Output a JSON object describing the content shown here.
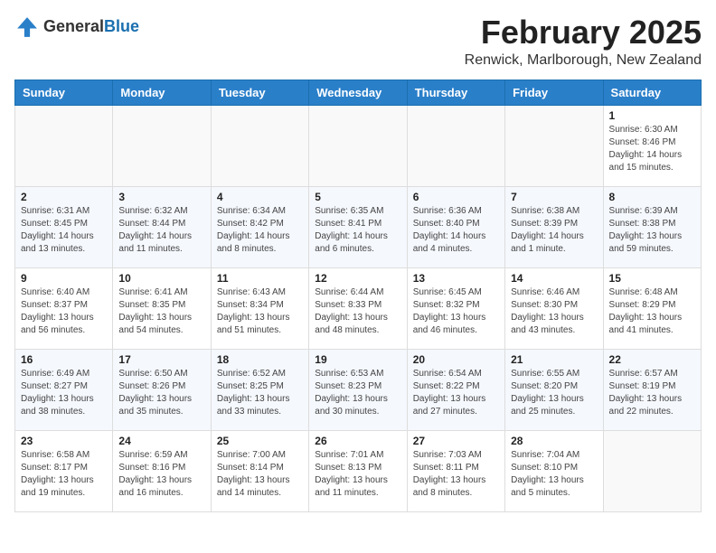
{
  "logo": {
    "general": "General",
    "blue": "Blue"
  },
  "title": {
    "month": "February 2025",
    "location": "Renwick, Marlborough, New Zealand"
  },
  "weekdays": [
    "Sunday",
    "Monday",
    "Tuesday",
    "Wednesday",
    "Thursday",
    "Friday",
    "Saturday"
  ],
  "weeks": [
    [
      {
        "day": "",
        "info": ""
      },
      {
        "day": "",
        "info": ""
      },
      {
        "day": "",
        "info": ""
      },
      {
        "day": "",
        "info": ""
      },
      {
        "day": "",
        "info": ""
      },
      {
        "day": "",
        "info": ""
      },
      {
        "day": "1",
        "info": "Sunrise: 6:30 AM\nSunset: 8:46 PM\nDaylight: 14 hours\nand 15 minutes."
      }
    ],
    [
      {
        "day": "2",
        "info": "Sunrise: 6:31 AM\nSunset: 8:45 PM\nDaylight: 14 hours\nand 13 minutes."
      },
      {
        "day": "3",
        "info": "Sunrise: 6:32 AM\nSunset: 8:44 PM\nDaylight: 14 hours\nand 11 minutes."
      },
      {
        "day": "4",
        "info": "Sunrise: 6:34 AM\nSunset: 8:42 PM\nDaylight: 14 hours\nand 8 minutes."
      },
      {
        "day": "5",
        "info": "Sunrise: 6:35 AM\nSunset: 8:41 PM\nDaylight: 14 hours\nand 6 minutes."
      },
      {
        "day": "6",
        "info": "Sunrise: 6:36 AM\nSunset: 8:40 PM\nDaylight: 14 hours\nand 4 minutes."
      },
      {
        "day": "7",
        "info": "Sunrise: 6:38 AM\nSunset: 8:39 PM\nDaylight: 14 hours\nand 1 minute."
      },
      {
        "day": "8",
        "info": "Sunrise: 6:39 AM\nSunset: 8:38 PM\nDaylight: 13 hours\nand 59 minutes."
      }
    ],
    [
      {
        "day": "9",
        "info": "Sunrise: 6:40 AM\nSunset: 8:37 PM\nDaylight: 13 hours\nand 56 minutes."
      },
      {
        "day": "10",
        "info": "Sunrise: 6:41 AM\nSunset: 8:35 PM\nDaylight: 13 hours\nand 54 minutes."
      },
      {
        "day": "11",
        "info": "Sunrise: 6:43 AM\nSunset: 8:34 PM\nDaylight: 13 hours\nand 51 minutes."
      },
      {
        "day": "12",
        "info": "Sunrise: 6:44 AM\nSunset: 8:33 PM\nDaylight: 13 hours\nand 48 minutes."
      },
      {
        "day": "13",
        "info": "Sunrise: 6:45 AM\nSunset: 8:32 PM\nDaylight: 13 hours\nand 46 minutes."
      },
      {
        "day": "14",
        "info": "Sunrise: 6:46 AM\nSunset: 8:30 PM\nDaylight: 13 hours\nand 43 minutes."
      },
      {
        "day": "15",
        "info": "Sunrise: 6:48 AM\nSunset: 8:29 PM\nDaylight: 13 hours\nand 41 minutes."
      }
    ],
    [
      {
        "day": "16",
        "info": "Sunrise: 6:49 AM\nSunset: 8:27 PM\nDaylight: 13 hours\nand 38 minutes."
      },
      {
        "day": "17",
        "info": "Sunrise: 6:50 AM\nSunset: 8:26 PM\nDaylight: 13 hours\nand 35 minutes."
      },
      {
        "day": "18",
        "info": "Sunrise: 6:52 AM\nSunset: 8:25 PM\nDaylight: 13 hours\nand 33 minutes."
      },
      {
        "day": "19",
        "info": "Sunrise: 6:53 AM\nSunset: 8:23 PM\nDaylight: 13 hours\nand 30 minutes."
      },
      {
        "day": "20",
        "info": "Sunrise: 6:54 AM\nSunset: 8:22 PM\nDaylight: 13 hours\nand 27 minutes."
      },
      {
        "day": "21",
        "info": "Sunrise: 6:55 AM\nSunset: 8:20 PM\nDaylight: 13 hours\nand 25 minutes."
      },
      {
        "day": "22",
        "info": "Sunrise: 6:57 AM\nSunset: 8:19 PM\nDaylight: 13 hours\nand 22 minutes."
      }
    ],
    [
      {
        "day": "23",
        "info": "Sunrise: 6:58 AM\nSunset: 8:17 PM\nDaylight: 13 hours\nand 19 minutes."
      },
      {
        "day": "24",
        "info": "Sunrise: 6:59 AM\nSunset: 8:16 PM\nDaylight: 13 hours\nand 16 minutes."
      },
      {
        "day": "25",
        "info": "Sunrise: 7:00 AM\nSunset: 8:14 PM\nDaylight: 13 hours\nand 14 minutes."
      },
      {
        "day": "26",
        "info": "Sunrise: 7:01 AM\nSunset: 8:13 PM\nDaylight: 13 hours\nand 11 minutes."
      },
      {
        "day": "27",
        "info": "Sunrise: 7:03 AM\nSunset: 8:11 PM\nDaylight: 13 hours\nand 8 minutes."
      },
      {
        "day": "28",
        "info": "Sunrise: 7:04 AM\nSunset: 8:10 PM\nDaylight: 13 hours\nand 5 minutes."
      },
      {
        "day": "",
        "info": ""
      }
    ]
  ]
}
